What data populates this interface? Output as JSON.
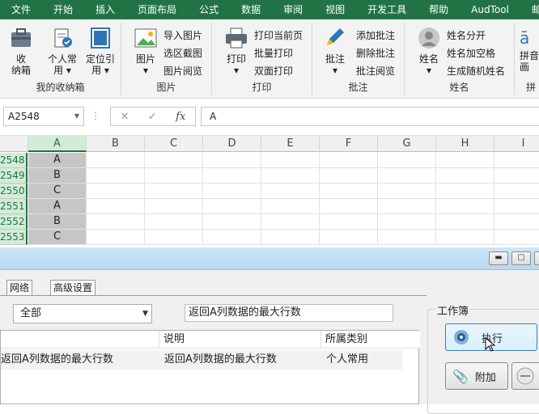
{
  "menu": [
    "文件",
    "开始",
    "插入",
    "页面布局",
    "公式",
    "数据",
    "审阅",
    "视图",
    "开发工具",
    "帮助",
    "AudTool",
    "邮"
  ],
  "ribbon": {
    "groups": [
      {
        "label": "我的收纳箱",
        "big": [
          {
            "label1": "收",
            "label2": "纳箱"
          },
          {
            "label1": "个人常",
            "label2": "用 ▾"
          },
          {
            "label1": "定位引",
            "label2": "用 ▾"
          }
        ]
      },
      {
        "label": "图片",
        "big": [
          {
            "label1": "图片",
            "label2": "▾"
          }
        ],
        "small": [
          "导入图片",
          "选区截图",
          "图片阅览"
        ]
      },
      {
        "label": "打印",
        "big": [
          {
            "label1": "打印",
            "label2": "▾"
          }
        ],
        "small": [
          "打印当前页",
          "批量打印",
          "双面打印"
        ]
      },
      {
        "label": "批注",
        "big": [
          {
            "label1": "批注",
            "label2": "▾"
          }
        ],
        "small": [
          "添加批注",
          "删除批注",
          "批注阅览"
        ]
      },
      {
        "label": "姓名",
        "big": [
          {
            "label1": "姓名",
            "label2": "▾"
          }
        ],
        "small": [
          "姓名分开",
          "姓名加空格",
          "生成随机姓名"
        ]
      },
      {
        "label": "拼",
        "big": [
          {
            "label1": "拼音",
            "label2": "画"
          }
        ]
      }
    ]
  },
  "formula_bar": {
    "name_box": "A2548",
    "content": "A",
    "fx": "fx"
  },
  "sheet": {
    "columns": [
      "A",
      "B",
      "C",
      "D",
      "E",
      "F",
      "G",
      "H",
      "I"
    ],
    "rows": [
      {
        "num": "2548",
        "a": "A"
      },
      {
        "num": "2549",
        "a": "B"
      },
      {
        "num": "2550",
        "a": "C"
      },
      {
        "num": "2551",
        "a": "A"
      },
      {
        "num": "2552",
        "a": "B"
      },
      {
        "num": "2553",
        "a": "C"
      }
    ]
  },
  "dialog": {
    "tabs": [
      "网络",
      "高级设置"
    ],
    "category": "全部",
    "description": "返回A列数据的最大行数",
    "list_headers": [
      "",
      "说明",
      "所属类别"
    ],
    "list_row": {
      "name": "返回A列数据的最大行数",
      "desc": "返回A列数据的最大行数",
      "category": "个人常用"
    },
    "workbook_label": "工作簿",
    "execute_label": "执行",
    "attach_label": "附加"
  },
  "colors": {
    "excel_green": "#217346",
    "selection": "#c6c6c6"
  }
}
